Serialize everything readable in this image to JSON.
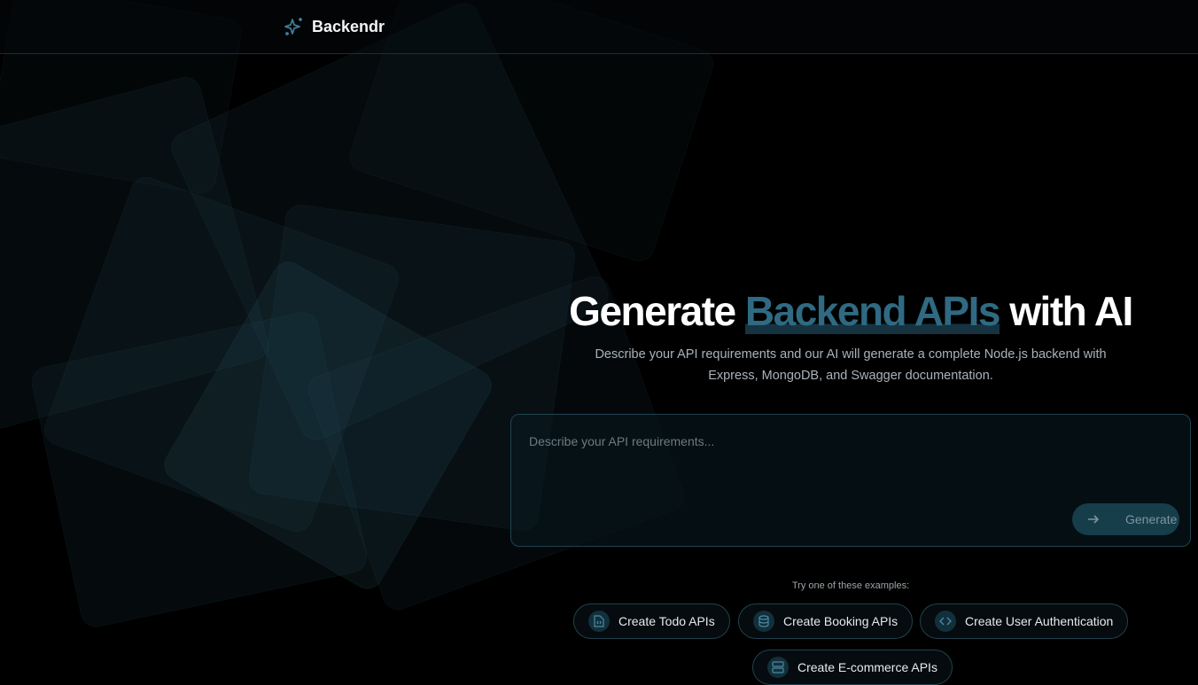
{
  "brand": {
    "name": "Backendr"
  },
  "hero": {
    "title_pre": "Generate ",
    "title_highlight": "Backend APIs",
    "title_post": " with AI",
    "subtitle_line1": "Describe your API requirements and our AI will generate a complete Node.js backend with",
    "subtitle_line2": "Express, MongoDB, and Swagger documentation."
  },
  "prompt": {
    "placeholder": "Describe your API requirements...",
    "generate_label": "Generate"
  },
  "examples": {
    "label": "Try one of these examples:",
    "items": [
      {
        "label": "Create Todo APIs",
        "icon": "file-code-icon"
      },
      {
        "label": "Create Booking APIs",
        "icon": "database-icon"
      },
      {
        "label": "Create User Authentication",
        "icon": "code-icon"
      },
      {
        "label": "Create E-commerce APIs",
        "icon": "server-icon"
      }
    ]
  },
  "colors": {
    "accent": "#2f6a82",
    "button": "#163d4a"
  }
}
